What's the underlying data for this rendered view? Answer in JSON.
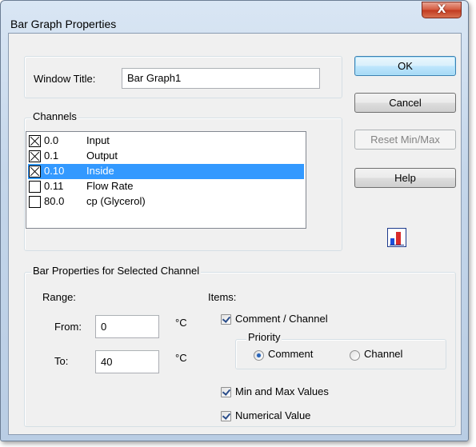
{
  "window": {
    "title": "Bar Graph Properties",
    "close_glyph": "X"
  },
  "window_title_field": {
    "label": "Window Title:",
    "value": "Bar Graph1"
  },
  "buttons": {
    "ok": "OK",
    "cancel": "Cancel",
    "reset": "Reset Min/Max",
    "help": "Help"
  },
  "channels": {
    "label": "Channels",
    "items": [
      {
        "checked": true,
        "channel": "0.0",
        "name": "Input",
        "selected": false
      },
      {
        "checked": true,
        "channel": "0.1",
        "name": "Output",
        "selected": false
      },
      {
        "checked": true,
        "channel": "0.10",
        "name": "Inside",
        "selected": true
      },
      {
        "checked": false,
        "channel": "0.11",
        "name": "Flow Rate",
        "selected": false
      },
      {
        "checked": false,
        "channel": "80.0",
        "name": "cp (Glycerol)",
        "selected": false
      }
    ]
  },
  "bar_properties": {
    "label": "Bar Properties for Selected Channel",
    "range_label": "Range:",
    "from_label": "From:",
    "from_value": "0",
    "from_unit": "°C",
    "to_label": "To:",
    "to_value": "40",
    "to_unit": "°C",
    "items_label": "Items:",
    "comment_channel": {
      "label": "Comment / Channel",
      "checked": true
    },
    "priority": {
      "label": "Priority",
      "options": [
        "Comment",
        "Channel"
      ],
      "selected": "Comment"
    },
    "min_max": {
      "label": "Min and Max Values",
      "checked": true
    },
    "numerical": {
      "label": "Numerical Value",
      "checked": true
    }
  },
  "colors": {
    "selection": "#3399ff",
    "chart_icon_bar_1": "#1d4ed8",
    "chart_icon_bar_2": "#d92c2c"
  },
  "icons": {
    "chart": "bar-chart-icon"
  }
}
